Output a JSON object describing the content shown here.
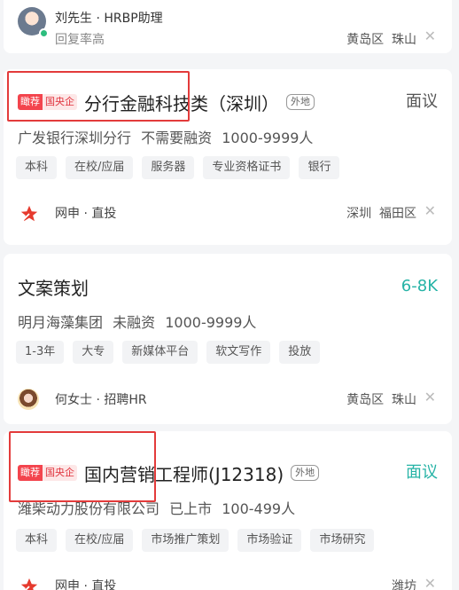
{
  "cards": [
    {
      "recruiter": "刘先生 · HRBP助理",
      "reply_rate": "回复率高",
      "district": "黄岛区",
      "area": "珠山"
    },
    {
      "badge_rec": "瞰荐",
      "badge_soe": "国央企",
      "title": "分行金融科技类（深圳）",
      "out_tag": "外地",
      "salary": "面议",
      "company": "广发银行深圳分行",
      "funding": "不需要融资",
      "size": "1000-9999人",
      "tags": [
        "本科",
        "在校/应届",
        "服务器",
        "专业资格证书",
        "银行"
      ],
      "apply": "网申 · 直投",
      "city": "深圳",
      "district": "福田区"
    },
    {
      "title": "文案策划",
      "salary": "6-8K",
      "company": "明月海藻集团",
      "funding": "未融资",
      "size": "1000-9999人",
      "tags": [
        "1-3年",
        "大专",
        "新媒体平台",
        "软文写作",
        "投放"
      ],
      "recruiter": "何女士 · 招聘HR",
      "district": "黄岛区",
      "area": "珠山"
    },
    {
      "badge_rec": "瞰荐",
      "badge_soe": "国央企",
      "title": "国内营销工程师(J12318)",
      "out_tag": "外地",
      "salary": "面议",
      "company": "潍柴动力股份有限公司",
      "funding": "已上市",
      "size": "100-499人",
      "tags": [
        "本科",
        "在校/应届",
        "市场推广策划",
        "市场验证",
        "市场研究"
      ],
      "apply": "网申 · 直投",
      "city": "潍坊"
    }
  ],
  "colors": {
    "badge_red": "#f3444d",
    "salary_teal": "#26b3a6",
    "highlight_box": "#e33b3b"
  },
  "icons": {
    "close": "close-icon",
    "apply": "red-star-icon"
  }
}
